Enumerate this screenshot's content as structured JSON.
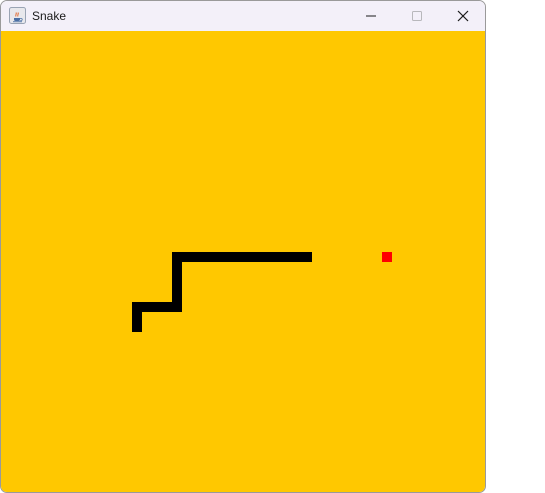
{
  "window": {
    "title": "Snake",
    "icon": "java-coffee-cup-icon",
    "controls": [
      "minimize-icon",
      "maximize-icon",
      "close-icon"
    ]
  },
  "game": {
    "board_color": "#ffc800",
    "snake_color": "#000000",
    "food_color": "#ff0000"
  }
}
